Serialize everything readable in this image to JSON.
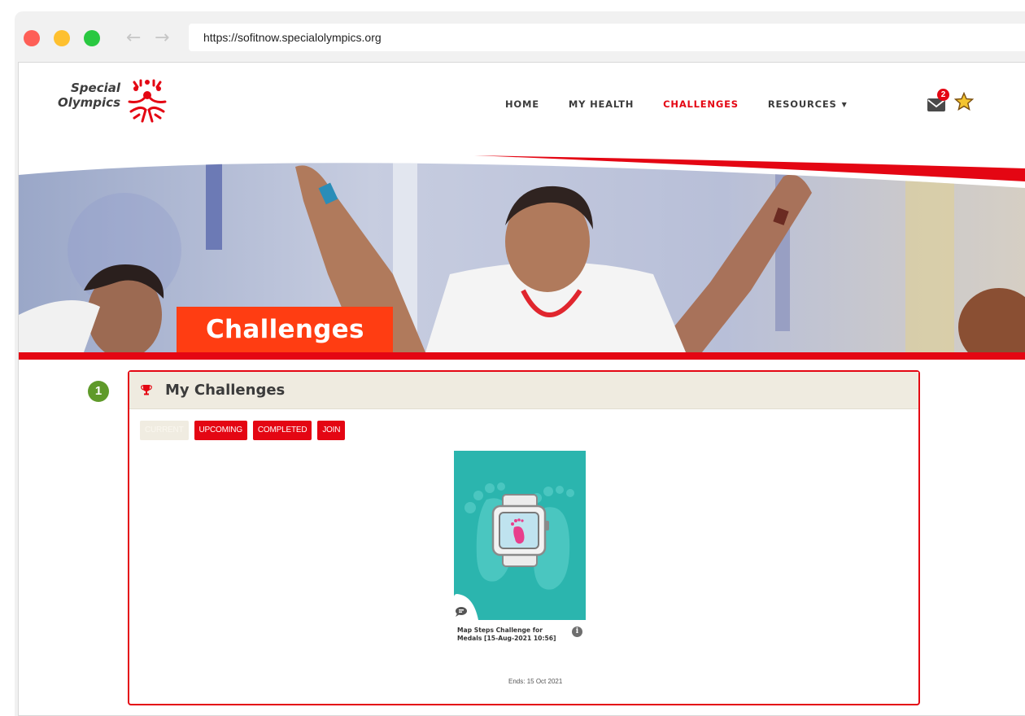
{
  "browser": {
    "url": "https://sofitnow.specialolympics.org",
    "back_icon": "←",
    "forward_icon": "→"
  },
  "header": {
    "logo_line1": "Special",
    "logo_line2": "Olympics",
    "nav": [
      {
        "label": "HOME",
        "active": false
      },
      {
        "label": "MY HEALTH",
        "active": false
      },
      {
        "label": "CHALLENGES",
        "active": true
      },
      {
        "label": "RESOURCES",
        "active": false,
        "caret": "▼"
      }
    ],
    "mail_badge": "2",
    "accent_color": "#e40613"
  },
  "hero": {
    "title": "Challenges",
    "title_bg_color": "#ff3d12"
  },
  "step_badge": "1",
  "panel": {
    "title": "My Challenges",
    "tabs": [
      {
        "label": "CURRENT",
        "selected": true
      },
      {
        "label": "UPCOMING",
        "selected": false
      },
      {
        "label": "COMPLETED",
        "selected": false
      },
      {
        "label": "JOIN",
        "selected": false
      }
    ],
    "card": {
      "title": "Map Steps Challenge for Medals [15-Aug-2021 10:56]",
      "info_icon": "i",
      "ends_label": "Ends:",
      "ends_date": "15 Oct 2021",
      "image_bg_color": "#2bb5ae"
    }
  }
}
